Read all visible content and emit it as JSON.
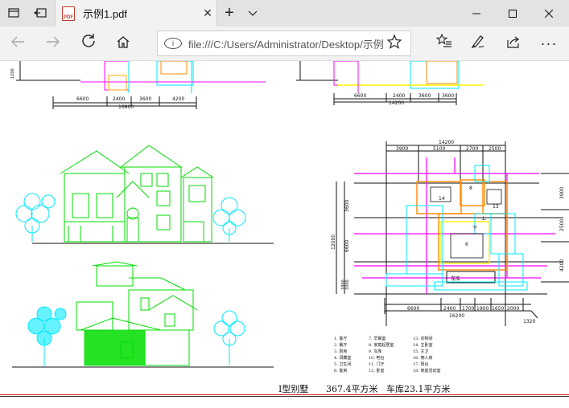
{
  "browser": {
    "tab_title": "示例1.pdf",
    "url": "file:///C:/Users/Administrator/Desktop/示例"
  },
  "icons": {
    "tab_actions": "tab-actions-icon",
    "set_aside": "set-aside-icon",
    "pdf": "pdf-file-icon",
    "close": "close-icon",
    "new_tab": "plus-icon",
    "tab_menu": "chevron-down-icon",
    "minimize": "minimize-icon",
    "maximize": "maximize-icon",
    "close_window": "close-window-icon",
    "back": "back-arrow-icon",
    "forward": "forward-arrow-icon",
    "refresh": "refresh-icon",
    "home": "home-icon",
    "site_info": "info-icon",
    "favorite": "star-icon",
    "favorites_hub": "favorites-list-icon",
    "notes": "pen-icon",
    "share": "share-icon",
    "more": "more-dots-icon"
  },
  "drawing": {
    "top_dims_left": [
      "6600",
      "2400",
      "3600",
      "4200",
      "16800"
    ],
    "top_dims_right": [
      "6600",
      "2400",
      "3600",
      "3600",
      "14200"
    ],
    "top_side_left": "1200",
    "plan_top_dims": [
      "14200",
      "3900",
      "5100",
      "2700",
      "2500"
    ],
    "plan_left_dims": [
      "3600",
      "12000",
      "6600",
      "1800",
      "3300"
    ],
    "plan_right_dims": [
      "3900",
      "2500",
      "4200"
    ],
    "plan_bottom_dims": [
      "6600",
      "2400",
      "1700",
      "1900",
      "1650",
      "2000",
      "16200"
    ],
    "plan_far_bottom": "1320",
    "room_labels": [
      "14",
      "6",
      "13",
      "8",
      "下",
      "上",
      "车库"
    ],
    "legend_col1": [
      "1. 客厅",
      "2. 餐厅",
      "3. 厨房",
      "4. 洞藏室",
      "5. 卫生间",
      "6. 客房"
    ],
    "legend_col2": [
      "7. 早餐室",
      "8. 家庭起居室",
      "9. 车库",
      "10. 吧台",
      "11. 门厅",
      "12. 卧室"
    ],
    "legend_col3": [
      "13. 衣物间",
      "14. 主卧室",
      "15. 主卫",
      "16. 佣人房",
      "17. 阳台",
      "18. 家庭活动室"
    ]
  },
  "caption": {
    "villa_type": "I型别墅",
    "area": "367.4平方米",
    "garage": "车库23.1平方米"
  }
}
